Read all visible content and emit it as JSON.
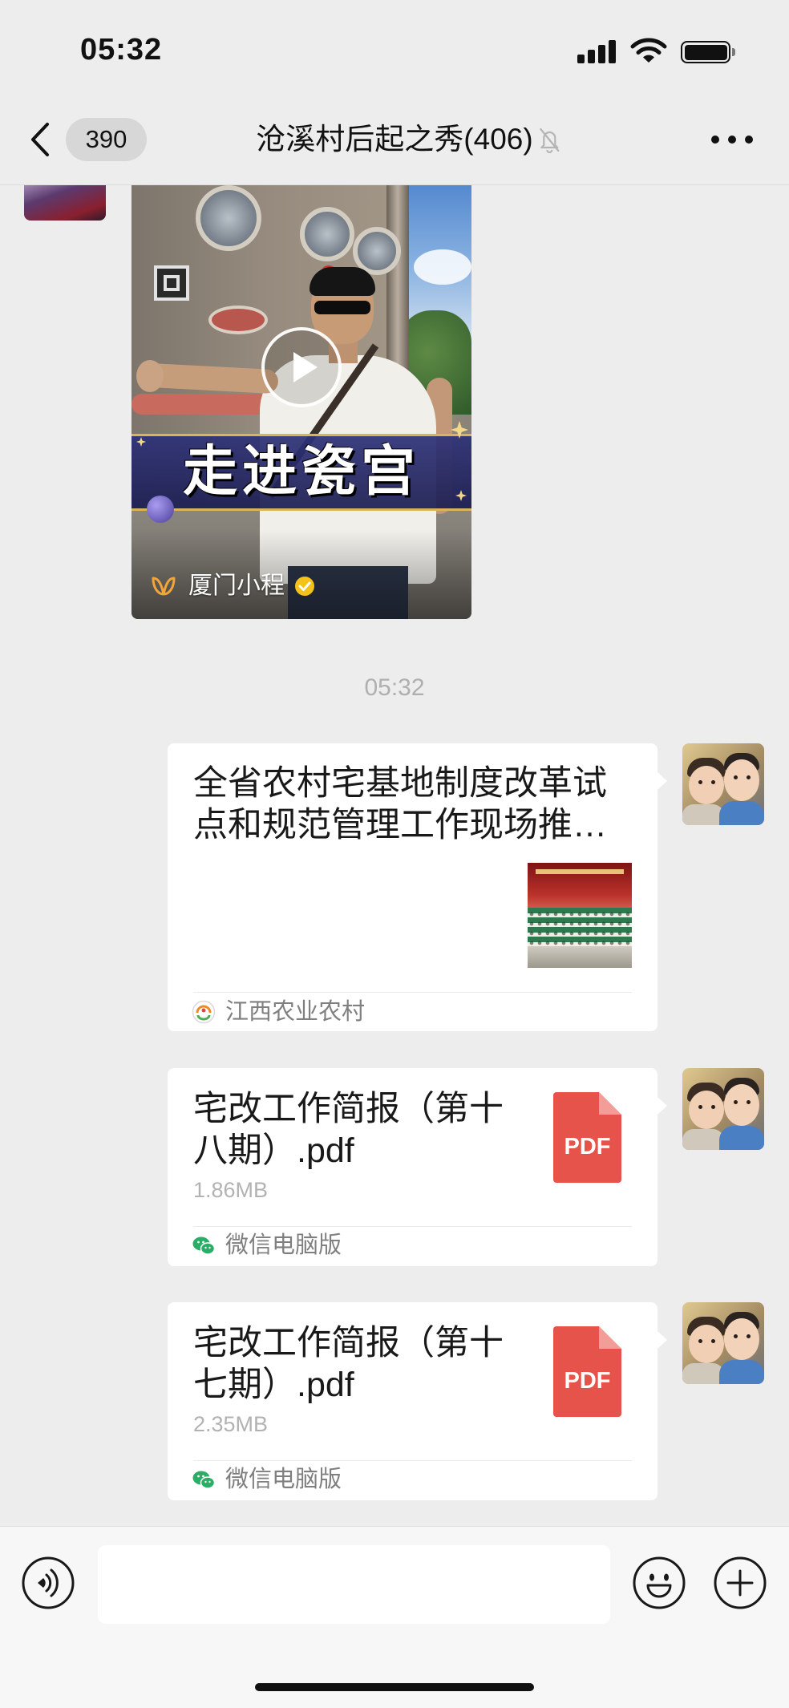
{
  "status_bar": {
    "time": "05:32",
    "icons": [
      "signal-icon",
      "wifi-icon",
      "battery-icon"
    ]
  },
  "header": {
    "unread_count": "390",
    "title": "沧溪村后起之秀(406)",
    "icons": [
      "back-chevron-icon",
      "mute-bell-icon",
      "more-dots-icon"
    ]
  },
  "chat": {
    "video_card": {
      "banner_text": "走进瓷宫",
      "channel_name": "厦门小程",
      "icons": [
        "play-icon",
        "channels-logo-icon",
        "verified-badge-icon"
      ]
    },
    "timestamp": "05:32",
    "link_card": {
      "title": "全省农村宅基地制度改革试点和规范管理工作现场推…",
      "source": "江西农业农村",
      "icons": [
        "source-logo-icon"
      ]
    },
    "files": [
      {
        "name": "宅改工作简报（第十八期）.pdf",
        "size": "1.86MB",
        "type_label": "PDF",
        "source": "微信电脑版"
      },
      {
        "name": "宅改工作简报（第十七期）.pdf",
        "size": "2.35MB",
        "type_label": "PDF",
        "source": "微信电脑版"
      }
    ]
  },
  "input_bar": {
    "message_text": "",
    "icons": [
      "voice-icon",
      "emoji-icon",
      "plus-icon"
    ]
  },
  "colors": {
    "background": "#EDEDED",
    "bubble": "#FFFFFF",
    "secondary_text": "#B2B2B2",
    "pdf_icon": "#E5534B",
    "wechat_green": "#2AAE67"
  }
}
